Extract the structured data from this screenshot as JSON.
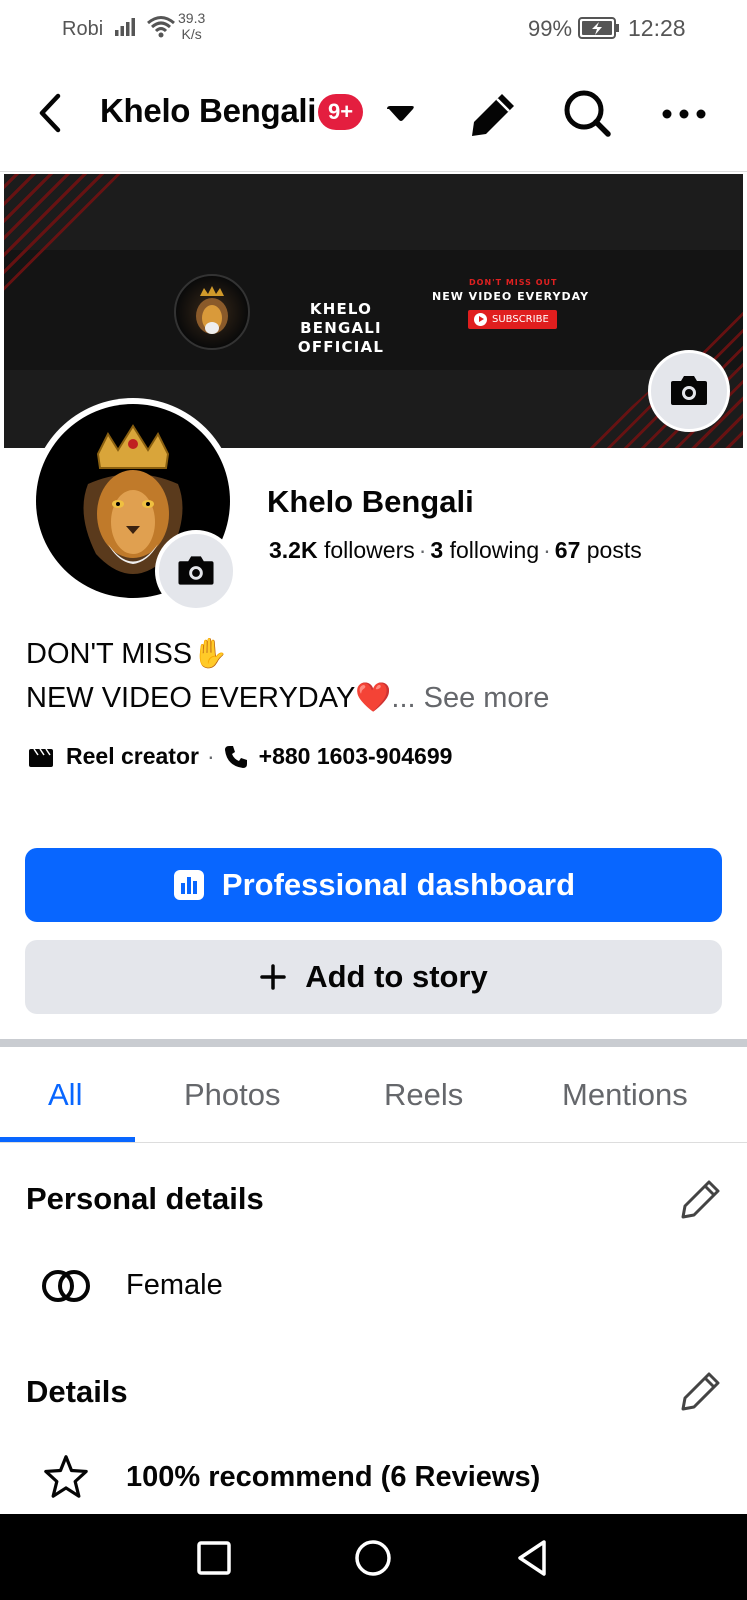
{
  "status_bar": {
    "carrier": "Robi",
    "net_speed_value": "39.3",
    "net_speed_unit": "K/s",
    "battery": "99%",
    "time": "12:28"
  },
  "header": {
    "title": "Khelo Bengali",
    "notification_badge": "9+"
  },
  "cover": {
    "brand_line1": "KHELO BENGALI",
    "brand_line2": "OFFICIAL",
    "tagline_small": "DON'T MISS OUT",
    "tagline": "NEW VIDEO EVERYDAY",
    "subscribe_label": "SUBSCRIBE"
  },
  "profile": {
    "name": "Khelo Bengali",
    "followers_count": "3.2K",
    "followers_label": "followers",
    "following_count": "3",
    "following_label": "following",
    "posts_count": "67",
    "posts_label": "posts",
    "bio_line1": "DON'T MISS✋",
    "bio_line2": "NEW VIDEO EVERYDAY❤️",
    "bio_seemore": "... See more",
    "category": "Reel creator",
    "phone": "+880 1603-904699"
  },
  "actions": {
    "dashboard_label": "Professional dashboard",
    "story_label": "Add to story"
  },
  "tabs": [
    "All",
    "Photos",
    "Reels",
    "Mentions"
  ],
  "active_tab": "All",
  "personal_details": {
    "title": "Personal details",
    "gender": "Female"
  },
  "details": {
    "title": "Details",
    "recommend": "100% recommend (6 Reviews)"
  },
  "colors": {
    "accent": "#0866ff",
    "badge": "#e41e3f",
    "secondary_button": "#e4e6eb",
    "muted_text": "#65676b"
  }
}
